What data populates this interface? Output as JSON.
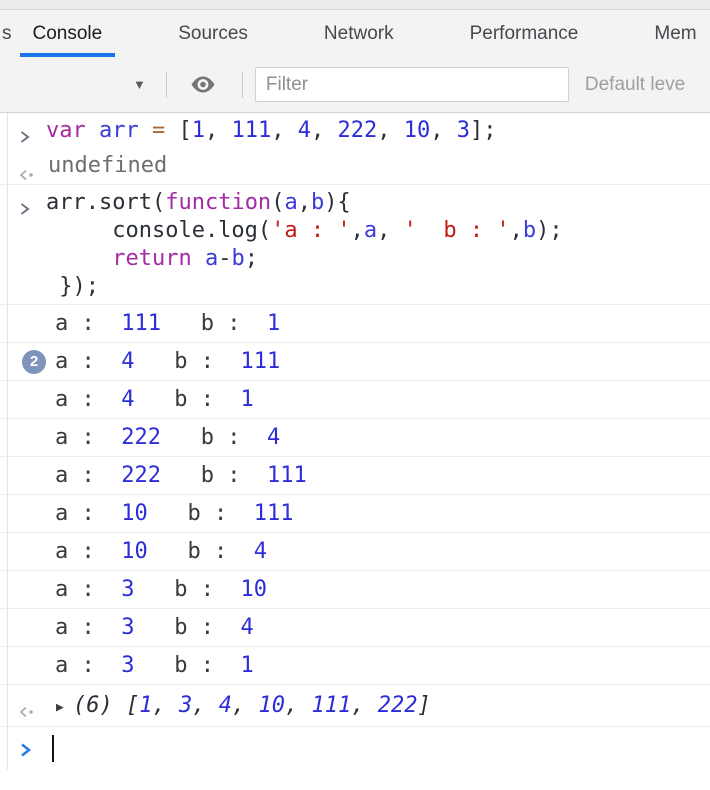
{
  "colors": {
    "accent": "#1a73e8",
    "badge": "#7f94bb",
    "keyword": "#a32ba3",
    "definition": "#3b3bd6",
    "number": "#2c2cd9",
    "string": "#c41a16",
    "operator": "#b0662e",
    "prompt_chevron": "#2b7ce9"
  },
  "tabbar": {
    "partial_tab": "s",
    "tabs": [
      {
        "label": "Console",
        "active": true
      },
      {
        "label": "Sources",
        "active": false
      },
      {
        "label": "Network",
        "active": false
      },
      {
        "label": "Performance",
        "active": false
      },
      {
        "label": "Mem",
        "active": false
      }
    ]
  },
  "toolbar": {
    "dropdown_arrow": "▼",
    "filter_placeholder": "Filter",
    "level_select": "Default leve"
  },
  "console": {
    "expand_arrow": "▶",
    "messages": [
      {
        "type": "command",
        "lines": [
          [
            {
              "c": "kw",
              "t": "var"
            },
            {
              "c": "pl",
              "t": " "
            },
            {
              "c": "def",
              "t": "arr"
            },
            {
              "c": "pl",
              "t": " "
            },
            {
              "c": "op",
              "t": "="
            },
            {
              "c": "pl",
              "t": " ["
            },
            {
              "c": "num",
              "t": "1"
            },
            {
              "c": "pl",
              "t": ", "
            },
            {
              "c": "num",
              "t": "111"
            },
            {
              "c": "pl",
              "t": ", "
            },
            {
              "c": "num",
              "t": "4"
            },
            {
              "c": "pl",
              "t": ", "
            },
            {
              "c": "num",
              "t": "222"
            },
            {
              "c": "pl",
              "t": ", "
            },
            {
              "c": "num",
              "t": "10"
            },
            {
              "c": "pl",
              "t": ", "
            },
            {
              "c": "num",
              "t": "3"
            },
            {
              "c": "pl",
              "t": "];"
            }
          ]
        ]
      },
      {
        "type": "result",
        "tokens": [
          {
            "c": "undef",
            "t": "undefined"
          }
        ]
      },
      {
        "type": "command",
        "lines": [
          [
            {
              "c": "pl",
              "t": "arr.sort("
            },
            {
              "c": "kw",
              "t": "function"
            },
            {
              "c": "pl",
              "t": "("
            },
            {
              "c": "def",
              "t": "a"
            },
            {
              "c": "pl",
              "t": ","
            },
            {
              "c": "def",
              "t": "b"
            },
            {
              "c": "pl",
              "t": "){"
            }
          ],
          [
            {
              "c": "pl",
              "t": "     console.log("
            },
            {
              "c": "str",
              "t": "'a : '"
            },
            {
              "c": "pl",
              "t": ","
            },
            {
              "c": "def",
              "t": "a"
            },
            {
              "c": "pl",
              "t": ", "
            },
            {
              "c": "str",
              "t": "'  b : '"
            },
            {
              "c": "pl",
              "t": ","
            },
            {
              "c": "def",
              "t": "b"
            },
            {
              "c": "pl",
              "t": ");"
            }
          ],
          [
            {
              "c": "pl",
              "t": "     "
            },
            {
              "c": "kw",
              "t": "return"
            },
            {
              "c": "pl",
              "t": " "
            },
            {
              "c": "def",
              "t": "a"
            },
            {
              "c": "pl",
              "t": "-"
            },
            {
              "c": "def",
              "t": "b"
            },
            {
              "c": "pl",
              "t": ";"
            }
          ],
          [
            {
              "c": "pl",
              "t": " });"
            }
          ]
        ]
      },
      {
        "type": "log",
        "tokens": [
          {
            "c": "pl",
            "t": "a :  "
          },
          {
            "c": "num",
            "t": "111"
          },
          {
            "c": "pl",
            "t": "   b :  "
          },
          {
            "c": "num",
            "t": "1"
          }
        ]
      },
      {
        "type": "log",
        "repeat": "2",
        "tokens": [
          {
            "c": "pl",
            "t": "a :  "
          },
          {
            "c": "num",
            "t": "4"
          },
          {
            "c": "pl",
            "t": "   b :  "
          },
          {
            "c": "num",
            "t": "111"
          }
        ]
      },
      {
        "type": "log",
        "tokens": [
          {
            "c": "pl",
            "t": "a :  "
          },
          {
            "c": "num",
            "t": "4"
          },
          {
            "c": "pl",
            "t": "   b :  "
          },
          {
            "c": "num",
            "t": "1"
          }
        ]
      },
      {
        "type": "log",
        "tokens": [
          {
            "c": "pl",
            "t": "a :  "
          },
          {
            "c": "num",
            "t": "222"
          },
          {
            "c": "pl",
            "t": "   b :  "
          },
          {
            "c": "num",
            "t": "4"
          }
        ]
      },
      {
        "type": "log",
        "tokens": [
          {
            "c": "pl",
            "t": "a :  "
          },
          {
            "c": "num",
            "t": "222"
          },
          {
            "c": "pl",
            "t": "   b :  "
          },
          {
            "c": "num",
            "t": "111"
          }
        ]
      },
      {
        "type": "log",
        "tokens": [
          {
            "c": "pl",
            "t": "a :  "
          },
          {
            "c": "num",
            "t": "10"
          },
          {
            "c": "pl",
            "t": "   b :  "
          },
          {
            "c": "num",
            "t": "111"
          }
        ]
      },
      {
        "type": "log",
        "tokens": [
          {
            "c": "pl",
            "t": "a :  "
          },
          {
            "c": "num",
            "t": "10"
          },
          {
            "c": "pl",
            "t": "   b :  "
          },
          {
            "c": "num",
            "t": "4"
          }
        ]
      },
      {
        "type": "log",
        "tokens": [
          {
            "c": "pl",
            "t": "a :  "
          },
          {
            "c": "num",
            "t": "3"
          },
          {
            "c": "pl",
            "t": "   b :  "
          },
          {
            "c": "num",
            "t": "10"
          }
        ]
      },
      {
        "type": "log",
        "tokens": [
          {
            "c": "pl",
            "t": "a :  "
          },
          {
            "c": "num",
            "t": "3"
          },
          {
            "c": "pl",
            "t": "   b :  "
          },
          {
            "c": "num",
            "t": "4"
          }
        ]
      },
      {
        "type": "log",
        "tokens": [
          {
            "c": "pl",
            "t": "a :  "
          },
          {
            "c": "num",
            "t": "3"
          },
          {
            "c": "pl",
            "t": "   b :  "
          },
          {
            "c": "num",
            "t": "1"
          }
        ]
      },
      {
        "type": "result",
        "expandable": true,
        "tokens": [
          {
            "c": "pl",
            "t": "(6) ["
          },
          {
            "c": "num",
            "t": "1"
          },
          {
            "c": "pl",
            "t": ", "
          },
          {
            "c": "num",
            "t": "3"
          },
          {
            "c": "pl",
            "t": ", "
          },
          {
            "c": "num",
            "t": "4"
          },
          {
            "c": "pl",
            "t": ", "
          },
          {
            "c": "num",
            "t": "10"
          },
          {
            "c": "pl",
            "t": ", "
          },
          {
            "c": "num",
            "t": "111"
          },
          {
            "c": "pl",
            "t": ", "
          },
          {
            "c": "num",
            "t": "222"
          },
          {
            "c": "pl",
            "t": "]"
          }
        ]
      }
    ]
  }
}
